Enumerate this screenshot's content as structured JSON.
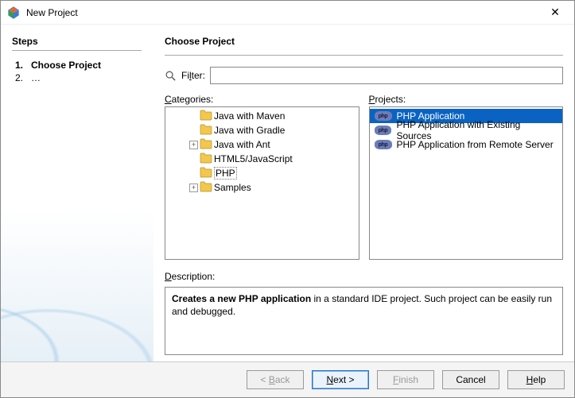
{
  "window": {
    "title": "New Project"
  },
  "sidebar": {
    "header": "Steps",
    "steps": [
      {
        "num": "1.",
        "label": "Choose Project",
        "current": true
      },
      {
        "num": "2.",
        "label": "…",
        "current": false
      }
    ]
  },
  "content": {
    "header": "Choose Project",
    "filter_label_pre": "Fi",
    "filter_label_u": "l",
    "filter_label_post": "ter:",
    "filter_value": "",
    "categories_label_u": "C",
    "categories_label_post": "ategories:",
    "projects_label_u": "P",
    "projects_label_post": "rojects:",
    "description_label_u": "D",
    "description_label_post": "escription:",
    "categories": [
      {
        "label": "Java with Maven",
        "expandable": false
      },
      {
        "label": "Java with Gradle",
        "expandable": false
      },
      {
        "label": "Java with Ant",
        "expandable": true
      },
      {
        "label": "HTML5/JavaScript",
        "expandable": false
      },
      {
        "label": "PHP",
        "expandable": false,
        "selected": true
      },
      {
        "label": "Samples",
        "expandable": true
      }
    ],
    "projects": [
      {
        "label": "PHP Application",
        "selected": true
      },
      {
        "label": "PHP Application with Existing Sources",
        "selected": false
      },
      {
        "label": "PHP Application from Remote Server",
        "selected": false
      }
    ],
    "description_strong": "Creates a new PHP application",
    "description_rest": " in a standard IDE project. Such project can be easily run and debugged."
  },
  "buttons": {
    "back": "< Back",
    "next": "Next >",
    "finish": "Finish",
    "cancel": "Cancel",
    "help": "Help"
  }
}
